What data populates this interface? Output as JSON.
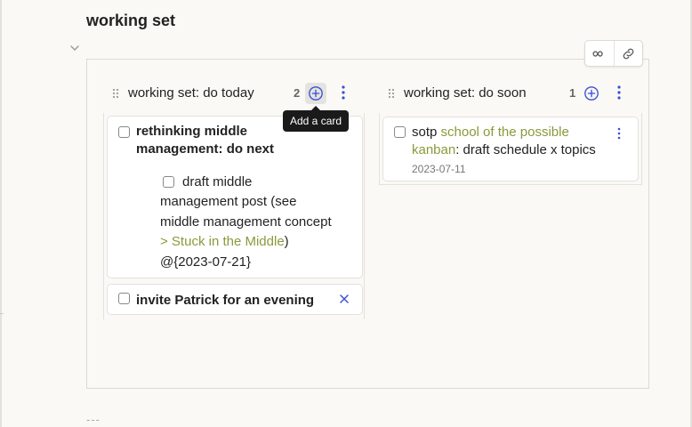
{
  "page": {
    "heading": "working set",
    "hr_marker": "---"
  },
  "board_toolbar": {
    "icons": [
      "infinity-icon",
      "link-icon"
    ]
  },
  "lanes": [
    {
      "title": "working set: do today",
      "count": "2",
      "tooltip": "Add a card",
      "cards": [
        {
          "title_line1": "rethinking middle",
          "title_line2": "management: do next",
          "subtask": {
            "text_part1": "draft middle",
            "text_part2": "management post (see",
            "link_part1": "middle management concept",
            "link_part2": "> Stuck in the Middle",
            "text_part3": ")",
            "date": "@{2023-07-21}"
          }
        },
        {
          "title": "invite Patrick for an evening"
        }
      ]
    },
    {
      "title": "working set: do soon",
      "count": "1",
      "cards": [
        {
          "prefix": "sotp ",
          "link_part1": "school of the possible",
          "link_part2": "kanban",
          "suffix": ": draft schedule x topics",
          "date": "2023-07-11"
        }
      ]
    }
  ],
  "colors": {
    "accent": "#3b4fd6",
    "link": "#8a9a3a",
    "background": "#faf9f5"
  }
}
